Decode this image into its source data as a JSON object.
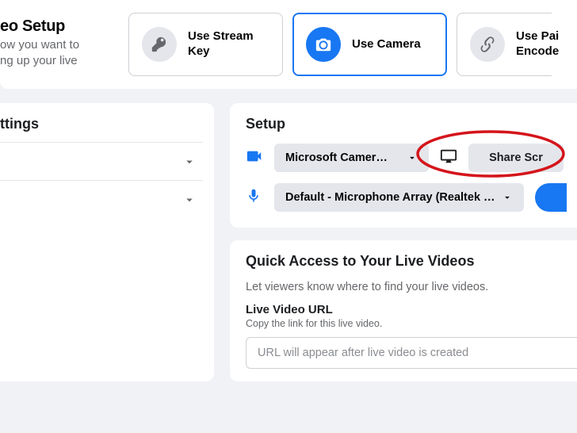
{
  "header": {
    "title": "eo Setup",
    "subtitle_line1": "ow you want to",
    "subtitle_line2": "ng up your live"
  },
  "options": {
    "stream_key": "Use Stream Key",
    "camera": "Use Camera",
    "paired": "Use Pai",
    "paired_line2": "Encode"
  },
  "settings": {
    "heading": "ttings"
  },
  "setup": {
    "heading": "Setup",
    "camera_dropdown": "Microsoft Camer…",
    "share_screen": "Share Scr",
    "mic_dropdown": "Default - Microphone Array (Realtek …"
  },
  "quick": {
    "heading": "Quick Access to Your Live Videos",
    "sub": "Let viewers know where to find your live videos.",
    "url_label": "Live Video URL",
    "url_caption": "Copy the link for this live video.",
    "url_placeholder": "URL will appear after live video is created"
  }
}
